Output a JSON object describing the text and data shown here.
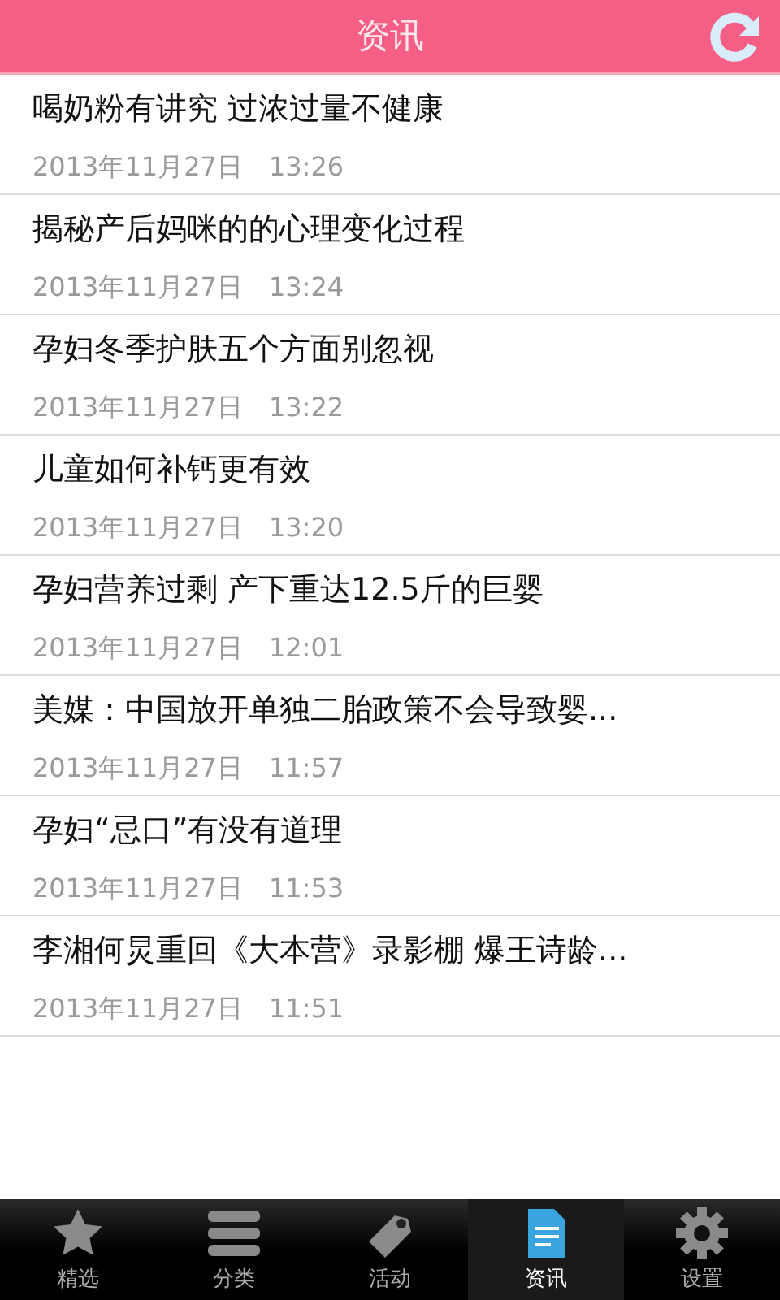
{
  "header": {
    "title": "资讯"
  },
  "articles": [
    {
      "title": "喝奶粉有讲究 过浓过量不健康",
      "date": "2013年11月27日",
      "time": "13:26"
    },
    {
      "title": "揭秘产后妈咪的的心理变化过程",
      "date": "2013年11月27日",
      "time": "13:24"
    },
    {
      "title": "孕妇冬季护肤五个方面别忽视",
      "date": "2013年11月27日",
      "time": "13:22"
    },
    {
      "title": "儿童如何补钙更有效",
      "date": "2013年11月27日",
      "time": "13:20"
    },
    {
      "title": "孕妇营养过剩 产下重达12.5斤的巨婴",
      "date": "2013年11月27日",
      "time": "12:01"
    },
    {
      "title": "美媒：中国放开单独二胎政策不会导致婴...",
      "date": "2013年11月27日",
      "time": "11:57"
    },
    {
      "title": "孕妇“忌口”有没有道理",
      "date": "2013年11月27日",
      "time": "11:53"
    },
    {
      "title": "李湘何炅重回《大本营》录影棚 爆王诗龄...",
      "date": "2013年11月27日",
      "time": "11:51"
    }
  ],
  "tabs": [
    {
      "kind": "star",
      "label": "精选",
      "selected": false
    },
    {
      "kind": "list",
      "label": "分类",
      "selected": false
    },
    {
      "kind": "tag",
      "label": "活动",
      "selected": false
    },
    {
      "kind": "news",
      "label": "资讯",
      "selected": true
    },
    {
      "kind": "gear",
      "label": "设置",
      "selected": false
    }
  ]
}
